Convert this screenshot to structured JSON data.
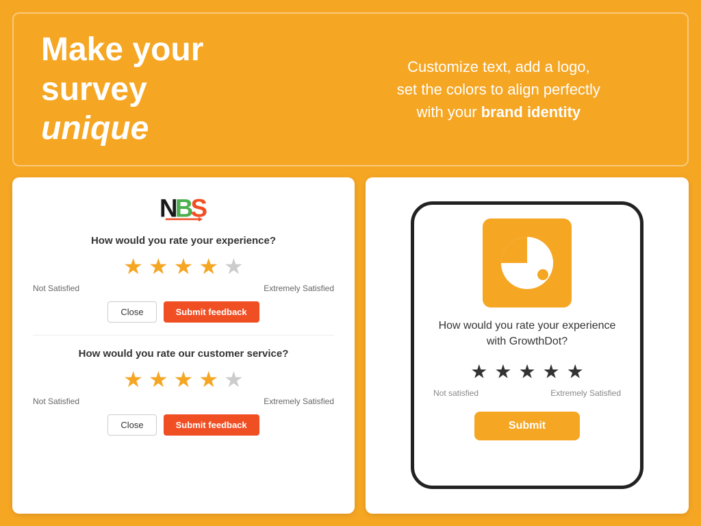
{
  "banner": {
    "left": {
      "line1": "Make your",
      "line2": "survey",
      "line3_normal": "",
      "line3_italic": "unique"
    },
    "right": {
      "text_part1": "Customize text, add a logo,",
      "text_part2": "set the colors to align perfectly",
      "text_part3": "with your ",
      "text_bold": "brand identity"
    }
  },
  "left_card": {
    "logo_alt": "NBS Logo",
    "section1": {
      "question": "How would you rate your experience?",
      "stars_filled": 4,
      "stars_total": 5,
      "label_left": "Not Satisfied",
      "label_right": "Extremely Satisfied",
      "btn_close": "Close",
      "btn_submit": "Submit feedback"
    },
    "section2": {
      "question": "How would you rate our customer service?",
      "stars_filled": 4,
      "stars_total": 5,
      "label_left": "Not Satisfied",
      "label_right": "Extremely Satisfied",
      "btn_close": "Close",
      "btn_submit": "Submit feedback"
    }
  },
  "right_card": {
    "logo_alt": "GrowthDot Logo",
    "question": "How would you rate your experience with GrowthDot?",
    "stars_total": 5,
    "label_left": "Not satisfied",
    "label_right": "Extremely Satisfied",
    "btn_submit": "Submit"
  }
}
